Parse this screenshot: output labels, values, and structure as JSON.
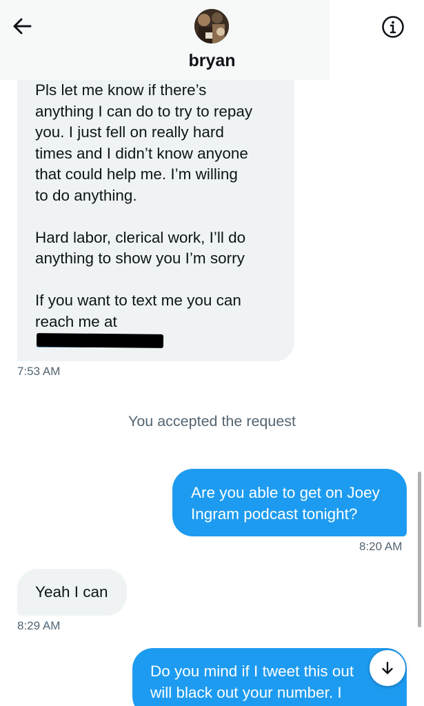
{
  "header": {
    "contact_name": "bryan",
    "back_icon": "arrow-left-icon",
    "info_icon": "info-circle-icon",
    "background": "#f7f9f9"
  },
  "messages": {
    "incoming_long": {
      "paragraphs": [
        "Pls let me know if there’s\nanything I can do to try to repay\nyou. I just fell on really hard\ntimes and I didn’t know anyone\nthat could help me.  I’m willing\nto do anything.",
        "Hard labor, clerical work, I’ll do\nanything to show you I’m sorry",
        "If you want to text me you can\nreach me at"
      ],
      "redacted": true,
      "time": "7:53 AM"
    },
    "system": "You accepted the request",
    "outgoing_1": {
      "text": "Are you able to get on Joey\nIngram podcast tonight?",
      "time": "8:20 AM"
    },
    "incoming_short": {
      "text": "Yeah I can",
      "time": "8:29 AM"
    },
    "outgoing_2": {
      "text": "Do you mind if I tweet this out\nwill black out your number. I"
    }
  },
  "scroll_button": {
    "icon": "arrow-down-icon"
  },
  "colors": {
    "accent": "#1d9bf0",
    "incoming_bubble": "#eff3f4",
    "secondary_text": "#536471"
  }
}
